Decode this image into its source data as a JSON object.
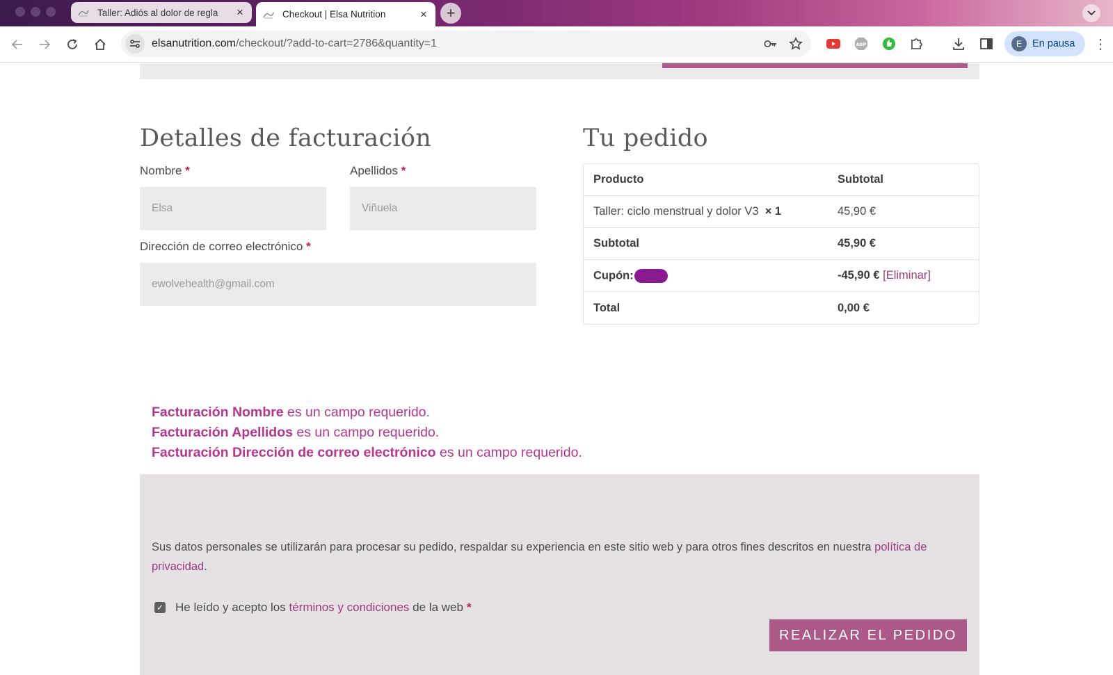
{
  "browser": {
    "tabs": [
      {
        "title": "Taller: Adiós al dolor de regla",
        "active": false
      },
      {
        "title": "Checkout | Elsa Nutrition",
        "active": true
      }
    ],
    "url_domain": "elsanutrition.com",
    "url_path": "/checkout/?add-to-cart=2786&quantity=1",
    "profile_initial": "E",
    "profile_label": "En pausa",
    "colors": {
      "tabbar_start": "#3b1a4d",
      "tabbar_end": "#e6b6c9",
      "profile_bg": "#d3e3fd"
    }
  },
  "billing": {
    "title": "Detalles de facturación",
    "first_name": {
      "label": "Nombre",
      "required_mark": "*",
      "placeholder": "Elsa"
    },
    "last_name": {
      "label": "Apellidos",
      "required_mark": "*",
      "placeholder": "Viñuela"
    },
    "email": {
      "label": "Dirección de correo electrónico",
      "required_mark": "*",
      "placeholder": "ewolvehealth@gmail.com"
    }
  },
  "order": {
    "title": "Tu pedido",
    "header": {
      "product": "Producto",
      "subtotal": "Subtotal"
    },
    "item": {
      "name": "Taller: ciclo menstrual y dolor V3",
      "qty": "× 1",
      "price": "45,90 €"
    },
    "subtotal": {
      "label": "Subtotal",
      "value": "45,90 €"
    },
    "coupon": {
      "label": "Cupón:",
      "value": "-45,90 €",
      "remove": "[Eliminar]"
    },
    "total": {
      "label": "Total",
      "value": "0,00 €"
    }
  },
  "errors": [
    {
      "field": "Facturación Nombre",
      "msg": "es un campo requerido."
    },
    {
      "field": "Facturación Apellidos",
      "msg": "es un campo requerido."
    },
    {
      "field": "Facturación Dirección de correo electrónico",
      "msg": "es un campo requerido."
    }
  ],
  "payment": {
    "privacy_text": "Sus datos personales se utilizarán para procesar su pedido, respaldar su experiencia en este sitio web y para otros fines descritos en nuestra",
    "privacy_link": "política de privacidad",
    "privacy_end": ".",
    "terms_prefix": "He leído y acepto los",
    "terms_link": "términos y condiciones",
    "terms_suffix": "de la web",
    "terms_required": "*",
    "terms_checked": true,
    "place_order": "REALIZAR EL PEDIDO",
    "colors": {
      "button": "#ac5987",
      "link": "#9a3c7c",
      "error": "#b5368c",
      "box_bg": "#e5e1e5"
    }
  }
}
